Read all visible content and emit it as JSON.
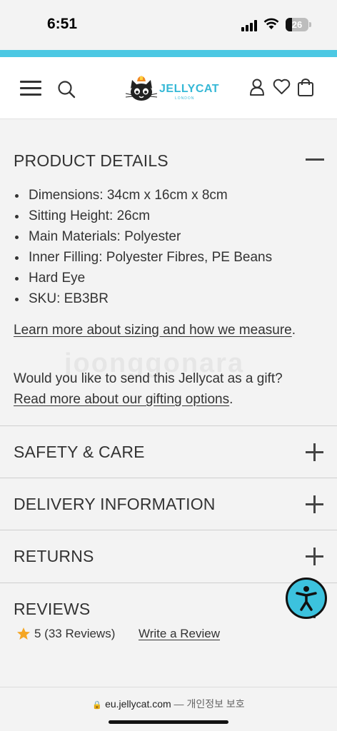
{
  "status_bar": {
    "time": "6:51",
    "battery": "26"
  },
  "header": {
    "logo_text": "JELLYCAT",
    "logo_sub": "LONDON",
    "icons": [
      "menu-icon",
      "search-icon",
      "account-icon",
      "wishlist-heart-icon",
      "bag-icon"
    ]
  },
  "product_details": {
    "title": "PRODUCT DETAILS",
    "items": [
      "Dimensions: 34cm x 16cm x 8cm",
      "Sitting Height: 26cm",
      "Main Materials: Polyester",
      "Inner Filling: Polyester Fibres, PE Beans",
      "Hard Eye",
      "SKU: EB3BR"
    ],
    "sizing_link": "Learn more about sizing and how we measure",
    "sizing_period": ".",
    "gift_text": "Would you like to send this Jellycat as a gift?",
    "gift_link": "Read more about our gifting options",
    "gift_period": "."
  },
  "sections": [
    {
      "title": "SAFETY & CARE"
    },
    {
      "title": "DELIVERY INFORMATION"
    },
    {
      "title": "RETURNS"
    }
  ],
  "reviews": {
    "title": "REVIEWS",
    "rating": "5 (33 Reviews)",
    "write_review": "Write a Review"
  },
  "browser": {
    "domain": "eu.jellycat.com",
    "separator": " — ",
    "privacy": "개인정보 보호"
  },
  "watermark": "joonggonara",
  "colors": {
    "brand": "#4cc8e3",
    "star": "#f5a623",
    "a11y": "#3cc2de"
  }
}
